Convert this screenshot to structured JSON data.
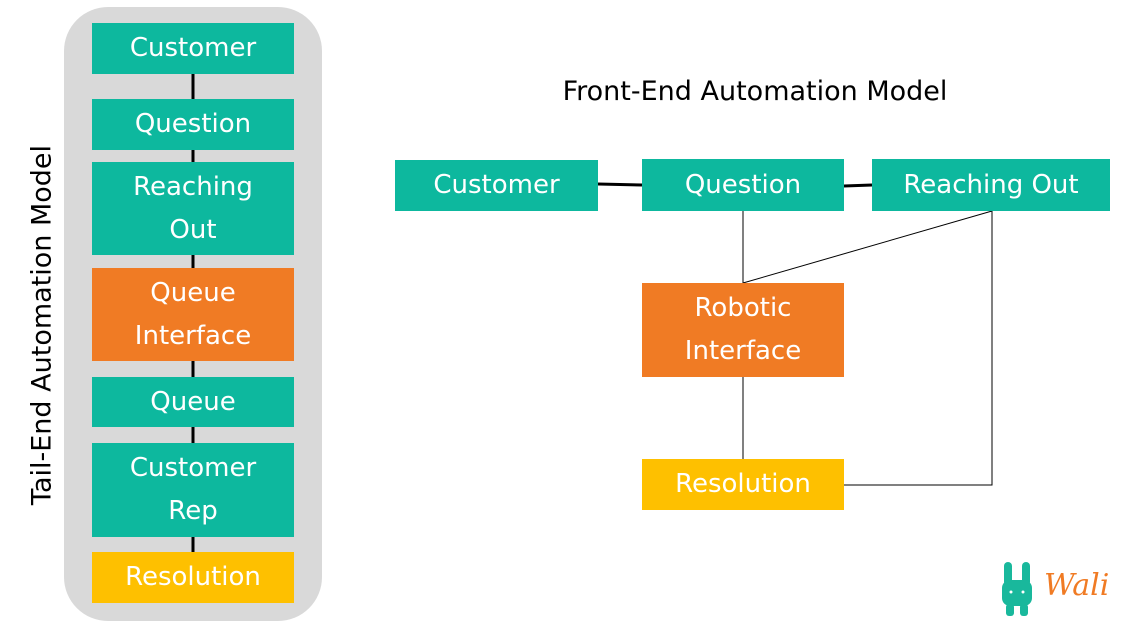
{
  "tail_end": {
    "title": "Tail-End Automation Model",
    "steps": [
      {
        "label": "Customer",
        "kind": "standard"
      },
      {
        "label": "Question",
        "kind": "standard"
      },
      {
        "label": "Reaching Out",
        "kind": "standard"
      },
      {
        "label": "Queue Interface",
        "kind": "interface"
      },
      {
        "label": "Queue",
        "kind": "standard"
      },
      {
        "label": "Customer Rep",
        "kind": "standard"
      },
      {
        "label": "Resolution",
        "kind": "outcome"
      }
    ]
  },
  "front_end": {
    "title": "Front-End Automation Model",
    "nodes": {
      "customer": "Customer",
      "question": "Question",
      "reaching_out": "Reaching Out",
      "robotic_interface": "Robotic Interface",
      "resolution": "Resolution"
    },
    "edges": [
      [
        "customer",
        "question"
      ],
      [
        "question",
        "reaching_out"
      ],
      [
        "question",
        "robotic_interface"
      ],
      [
        "reaching_out",
        "robotic_interface"
      ],
      [
        "robotic_interface",
        "resolution"
      ],
      [
        "reaching_out",
        "resolution"
      ]
    ]
  },
  "colors": {
    "standard": "#0db89e",
    "interface": "#f07b24",
    "outcome": "#fec000",
    "panel": "#d9d9d9"
  },
  "logo": {
    "text": "Wali"
  }
}
